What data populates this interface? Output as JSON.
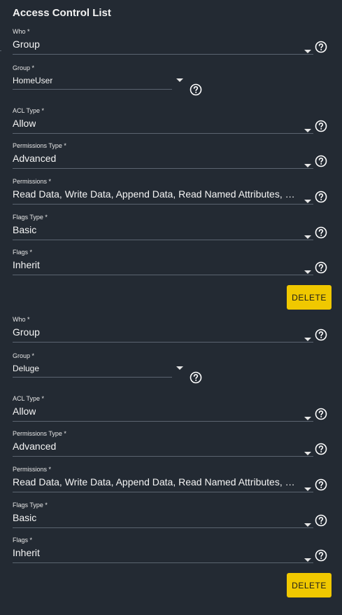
{
  "title": "Access Control List",
  "entries": [
    {
      "who_label": "Who *",
      "who_value": "Group",
      "group_label": "Group *",
      "group_value": "HomeUser",
      "acl_type_label": "ACL Type *",
      "acl_type_value": "Allow",
      "perm_type_label": "Permissions Type *",
      "perm_type_value": "Advanced",
      "perms_label": "Permissions *",
      "perms_value": "Read Data, Write Data, Append Data, Read Named Attributes, Wri...",
      "flags_type_label": "Flags Type *",
      "flags_type_value": "Basic",
      "flags_label": "Flags *",
      "flags_value": "Inherit",
      "delete_label": "DELETE"
    },
    {
      "who_label": "Who *",
      "who_value": "Group",
      "group_label": "Group *",
      "group_value": "Deluge",
      "acl_type_label": "ACL Type *",
      "acl_type_value": "Allow",
      "perm_type_label": "Permissions Type *",
      "perm_type_value": "Advanced",
      "perms_label": "Permissions *",
      "perms_value": "Read Data, Write Data, Append Data, Read Named Attributes, Wri...",
      "flags_type_label": "Flags Type *",
      "flags_type_value": "Basic",
      "flags_label": "Flags *",
      "flags_value": "Inherit",
      "delete_label": "DELETE"
    }
  ],
  "colors": {
    "background": "#232a33",
    "accent": "#f0c800",
    "underline": "#5b6470"
  },
  "icons": {
    "dropdown": "chevron-down-icon",
    "help": "help-circle-icon"
  }
}
